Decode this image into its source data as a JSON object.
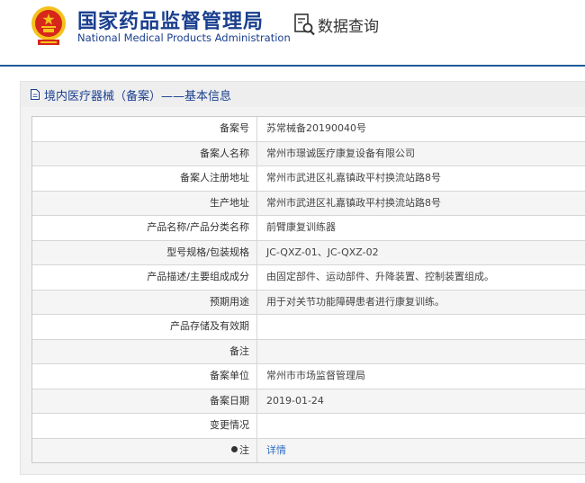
{
  "header": {
    "title_cn": "国家药品监督管理局",
    "title_en": "National Medical Products Administration",
    "query_label": "数据查询"
  },
  "panel": {
    "title": "境内医疗器械（备案）——基本信息"
  },
  "rows": [
    {
      "label": "备案号",
      "value": "苏常械备20190040号"
    },
    {
      "label": "备案人名称",
      "value": "常州市璟诚医疗康复设备有限公司"
    },
    {
      "label": "备案人注册地址",
      "value": "常州市武进区礼嘉镇政平村换流站路8号"
    },
    {
      "label": "生产地址",
      "value": "常州市武进区礼嘉镇政平村换流站路8号"
    },
    {
      "label": "产品名称/产品分类名称",
      "value": "前臂康复训练器"
    },
    {
      "label": "型号规格/包装规格",
      "value": "JC-QXZ-01、JC-QXZ-02"
    },
    {
      "label": "产品描述/主要组成成分",
      "value": "由固定部件、运动部件、升降装置、控制装置组成。"
    },
    {
      "label": "预期用途",
      "value": "用于对关节功能障碍患者进行康复训练。"
    },
    {
      "label": "产品存储及有效期",
      "value": ""
    },
    {
      "label": "备注",
      "value": ""
    },
    {
      "label": "备案单位",
      "value": "常州市市场监督管理局"
    },
    {
      "label": "备案日期",
      "value": "2019-01-24"
    },
    {
      "label": "变更情况",
      "value": ""
    },
    {
      "label": "注",
      "value": "详情"
    }
  ],
  "colors": {
    "brand": "#1a3f8f",
    "link": "#2f6fc1",
    "header_line": "#1e5a9a",
    "emblem_red": "#d7261a",
    "emblem_gold": "#f4c21b"
  },
  "icons": {
    "emblem": "national-emblem",
    "query": "document-search-icon",
    "panel": "document-icon",
    "note": "bullet-dot"
  }
}
